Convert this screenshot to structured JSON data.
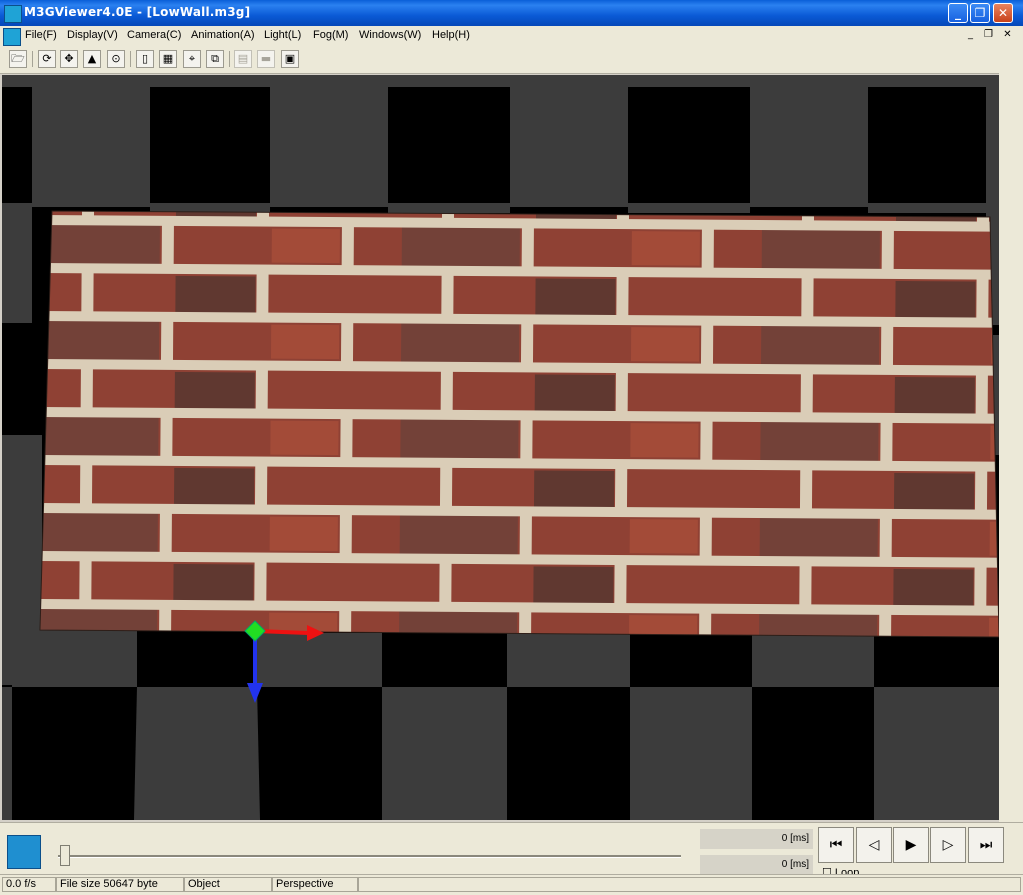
{
  "window": {
    "title": "M3GViewer4.0E - [LowWall.m3g]",
    "minimize_glyph": "_",
    "restore_glyph": "❐",
    "close_glyph": "✕"
  },
  "menu": {
    "items": [
      "File(F)",
      "Display(V)",
      "Camera(C)",
      "Animation(A)",
      "Light(L)",
      "Fog(M)",
      "Windows(W)",
      "Help(H)"
    ],
    "mdi_minimize": "_",
    "mdi_restore": "❐",
    "mdi_close": "✕"
  },
  "toolbar": {
    "buttons": [
      {
        "name": "open-file-icon",
        "glyph": "🗁"
      },
      {
        "name": "rotate-icon",
        "glyph": "⟳"
      },
      {
        "name": "move-icon",
        "glyph": "✥"
      },
      {
        "name": "up-arrow-icon",
        "glyph": "▲"
      },
      {
        "name": "zoom-fit-icon",
        "glyph": "⊙"
      },
      {
        "name": "page-icon",
        "glyph": "▯"
      },
      {
        "name": "grid-icon",
        "glyph": "▦"
      },
      {
        "name": "axes-icon",
        "glyph": "⌖"
      },
      {
        "name": "copy-icon",
        "glyph": "⧉"
      },
      {
        "name": "texture-icon",
        "glyph": "▤"
      },
      {
        "name": "plane-icon",
        "glyph": "▬"
      },
      {
        "name": "screen-icon",
        "glyph": "▣"
      }
    ]
  },
  "playback": {
    "time_current": "0 [ms]",
    "time_total": "0 [ms]",
    "buttons": [
      {
        "name": "skip-to-start-icon",
        "glyph": "⏮"
      },
      {
        "name": "step-back-icon",
        "glyph": "◁"
      },
      {
        "name": "play-icon",
        "glyph": "▶"
      },
      {
        "name": "step-forward-icon",
        "glyph": "▷"
      },
      {
        "name": "skip-to-end-icon",
        "glyph": "⏭"
      }
    ],
    "loop_label": "Loop",
    "slider_position": 0
  },
  "status": {
    "fps": "0.0  f/s",
    "file_size": "File size 50647 byte",
    "selection": "Object",
    "projection": "Perspective"
  },
  "colors": {
    "floor_dark": "#000000",
    "floor_light": "#3c3c3c",
    "brick": "#8b3a2c",
    "mortar": "#d9cbb5",
    "axis_x": "#ee1111",
    "axis_y": "#2233ee",
    "origin": "#22dd22"
  }
}
